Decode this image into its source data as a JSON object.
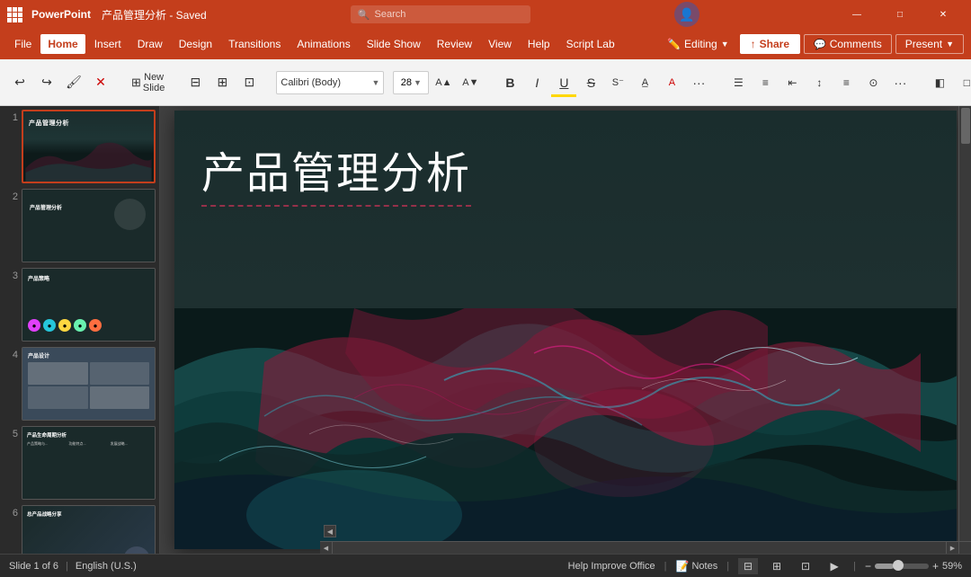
{
  "titlebar": {
    "app_name": "PowerPoint",
    "doc_title": "产品管理分析 - Saved",
    "search_placeholder": "Search",
    "editing_label": "Editing"
  },
  "menu": {
    "items": [
      "File",
      "Home",
      "Insert",
      "Draw",
      "Design",
      "Transitions",
      "Animations",
      "Slide Show",
      "Review",
      "View",
      "Help",
      "Script Lab"
    ],
    "active": "Home",
    "share_label": "Share",
    "comments_label": "Comments",
    "present_label": "Present",
    "editing_label": "Editing"
  },
  "ribbon": {
    "new_slide_label": "New Slide",
    "font_name": "",
    "font_size": "",
    "more_label": "···"
  },
  "slides": [
    {
      "num": "1",
      "title": "产品管理分析",
      "type": "title"
    },
    {
      "num": "2",
      "title": "产品管理分析",
      "type": "section"
    },
    {
      "num": "3",
      "title": "产品策略",
      "type": "products"
    },
    {
      "num": "4",
      "title": "产品设计",
      "type": "puzzle"
    },
    {
      "num": "5",
      "title": "产品生命周期分析",
      "type": "features"
    },
    {
      "num": "6",
      "title": "总产品战略分享",
      "type": "strategy"
    }
  ],
  "main_slide": {
    "title": "产品管理分析"
  },
  "statusbar": {
    "slide_info": "Slide 1 of 6",
    "language": "English (U.S.)",
    "help_text": "Help Improve Office",
    "notes_label": "Notes",
    "zoom_level": "59%"
  }
}
